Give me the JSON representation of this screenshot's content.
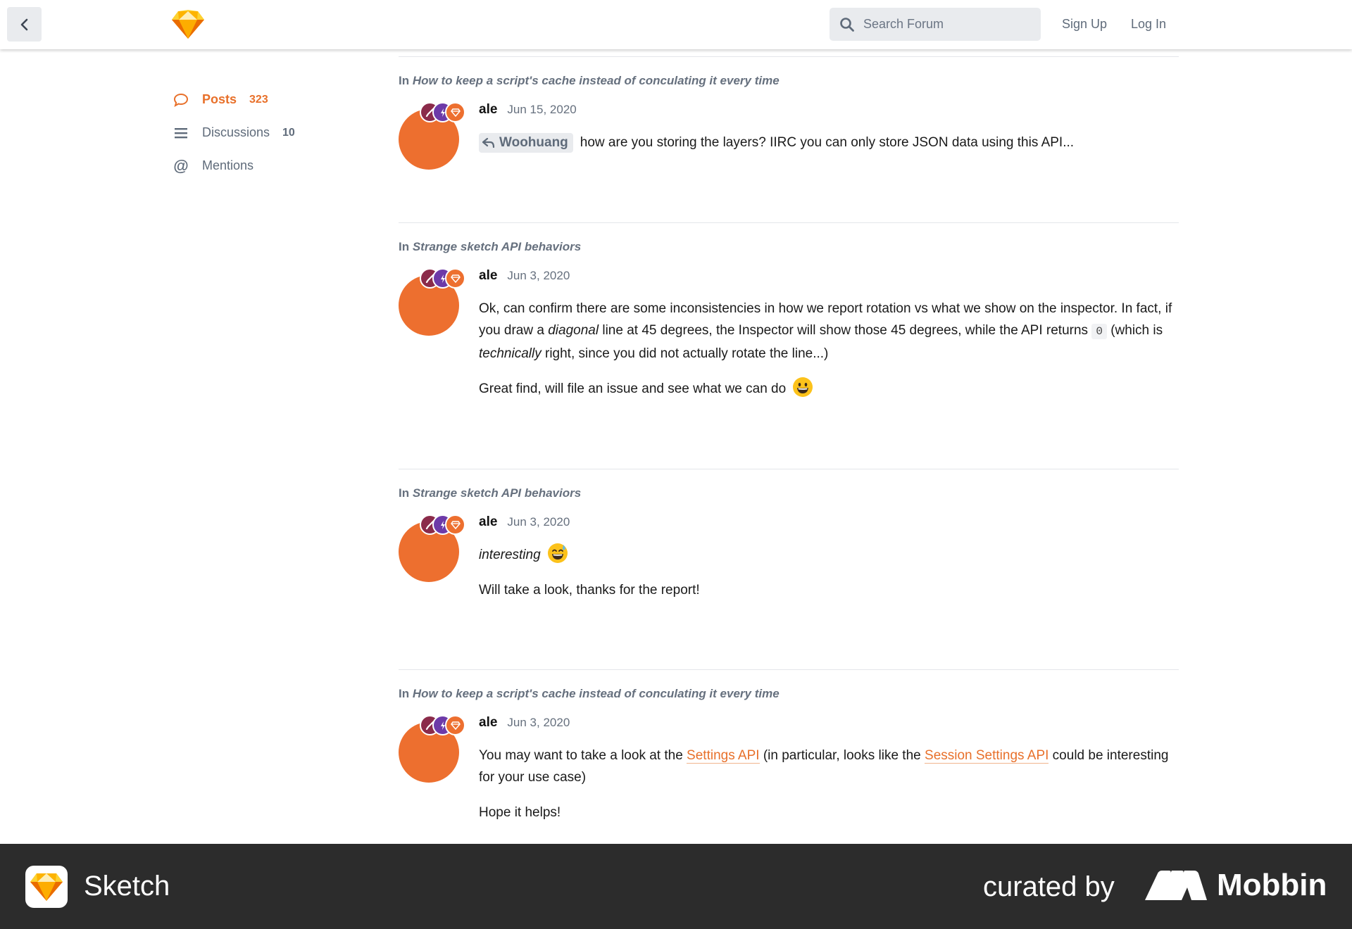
{
  "header": {
    "search_placeholder": "Search Forum",
    "sign_up": "Sign Up",
    "log_in": "Log In"
  },
  "sidebar": {
    "items": [
      {
        "label": "Posts",
        "count": "323",
        "icon": "speech-bubble-icon",
        "active": true
      },
      {
        "label": "Discussions",
        "count": "10",
        "icon": "list-icon"
      },
      {
        "label": "Mentions",
        "count": "",
        "icon": "at-sign-icon"
      }
    ]
  },
  "posts": [
    {
      "context_prefix": "In",
      "context_title": "How to keep a script's cache instead of conculating it every time",
      "author": "ale",
      "date": "Jun 15, 2020",
      "reply_to": "Woohuang",
      "text": "how are you storing the layers? IIRC you can only store JSON data using this API..."
    },
    {
      "context_prefix": "In",
      "context_title": "Strange sketch API behaviors",
      "author": "ale",
      "date": "Jun 3, 2020",
      "p1_a": "Ok, can confirm there are some inconsistencies in how we report rotation vs what we show on the inspector. In fact, if you draw a ",
      "p1_em": "diagonal",
      "p1_b": " line at 45 degrees, the Inspector will show those 45 degrees, while the API returns ",
      "p1_code": "0",
      "p1_c": " (which is ",
      "p1_em2": "technically",
      "p1_d": " right, since you did not actually rotate the line...)",
      "p2": "Great find, will file an issue and see what we can do"
    },
    {
      "context_prefix": "In",
      "context_title": "Strange sketch API behaviors",
      "author": "ale",
      "date": "Jun 3, 2020",
      "p1_em": "interesting",
      "p2": "Will take a look, thanks for the report!"
    },
    {
      "context_prefix": "In",
      "context_title": "How to keep a script's cache instead of conculating it every time",
      "author": "ale",
      "date": "Jun 3, 2020",
      "p1_a": "You may want to take a look at the ",
      "p1_link1": "Settings API",
      "p1_b": " (in particular, looks like the ",
      "p1_link2": "Session Settings API",
      "p1_c": " could be interesting for your use case)",
      "p2": "Hope it helps!"
    }
  ],
  "footer": {
    "app_name": "Sketch",
    "curated_by": "curated by",
    "brand": "Mobbin"
  },
  "colors": {
    "accent": "#e8702a",
    "avatar": "#ed6f2f",
    "footer_bg": "#2c2c2c"
  }
}
